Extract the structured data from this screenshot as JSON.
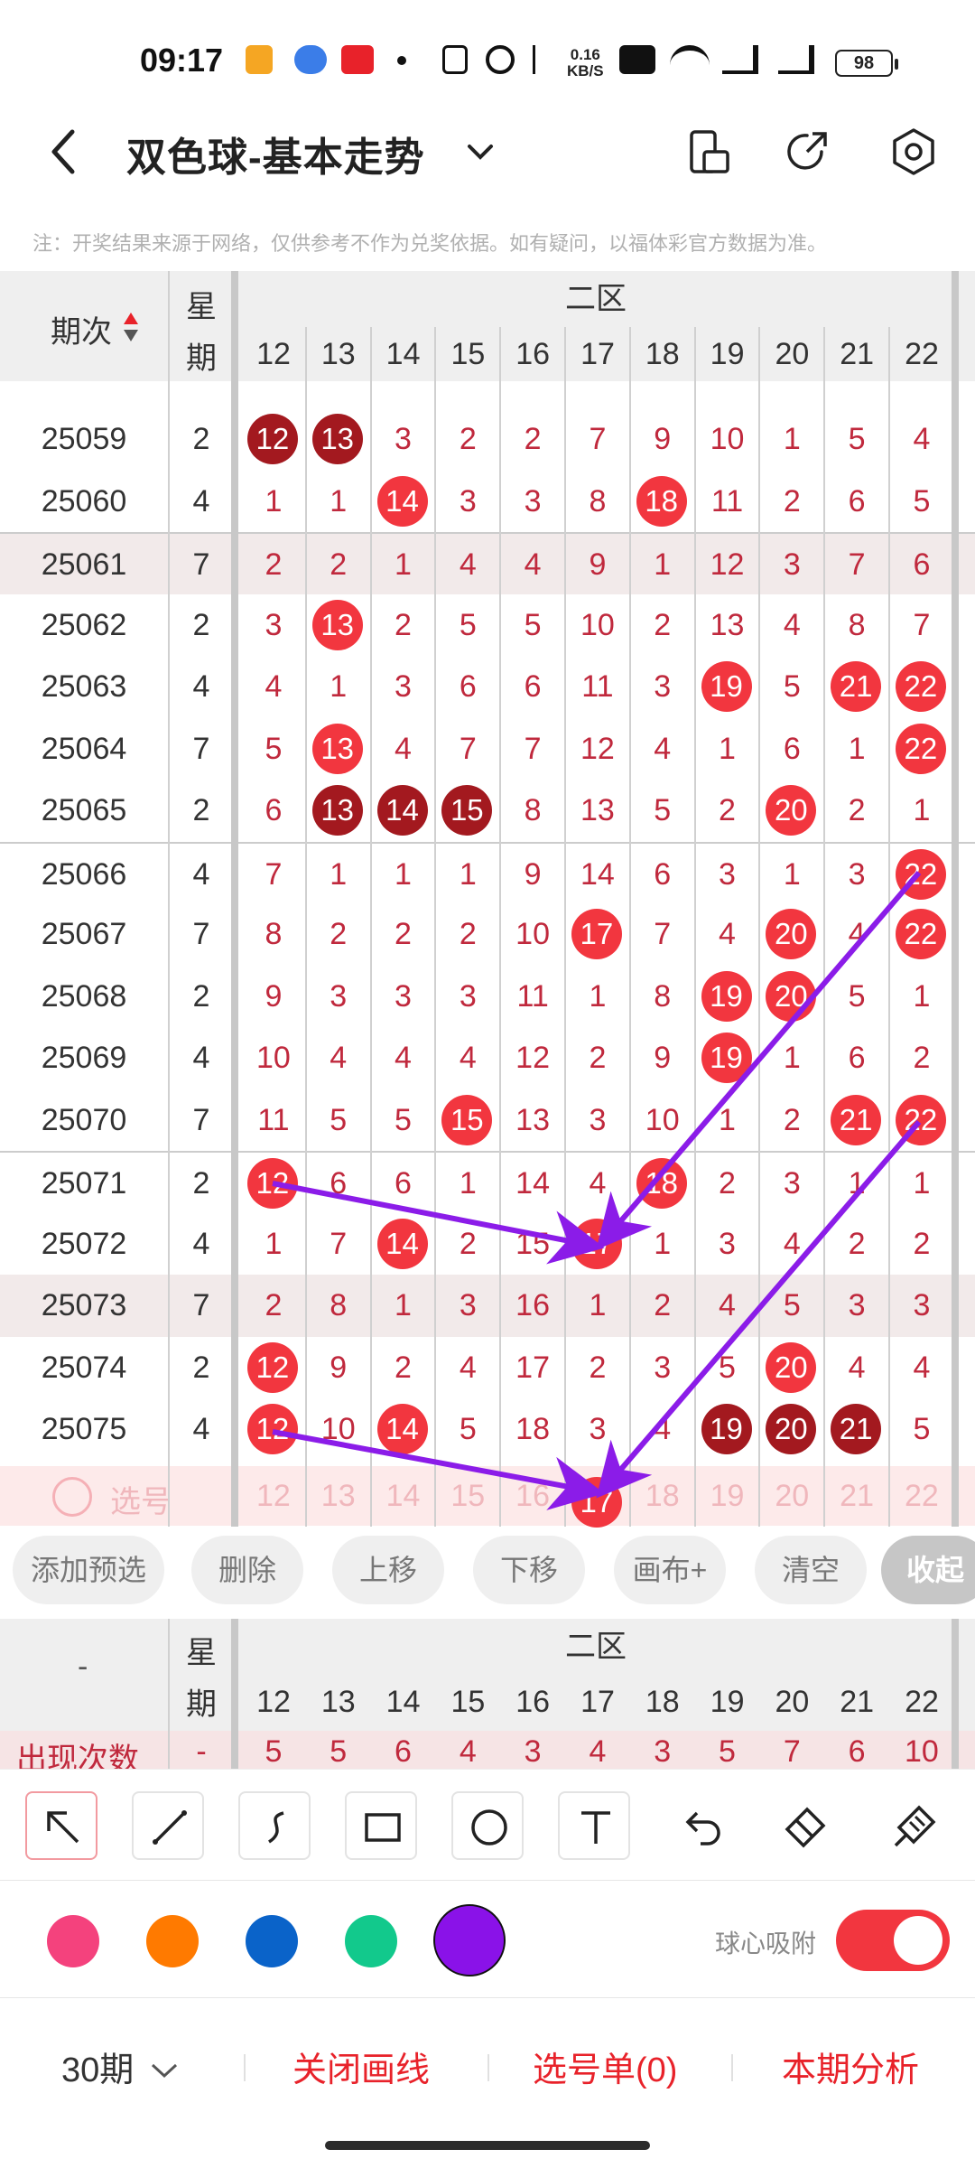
{
  "status_bar": {
    "time": "09:17",
    "net_speed_top": "0.16",
    "net_speed_bottom": "KB/S",
    "battery": "98"
  },
  "header": {
    "title": "双色球-基本走势"
  },
  "notice": "注：开奖结果来源于网络，仅供参考不作为兑奖依据。如有疑问，以福体彩官方数据为准。",
  "table": {
    "period_header": "期次",
    "week_header_top": "星",
    "week_header_bottom": "期",
    "zone_label": "二区",
    "columns": [
      "12",
      "13",
      "14",
      "15",
      "16",
      "17",
      "18",
      "19",
      "20",
      "21",
      "22"
    ],
    "rows": [
      {
        "period": "25059",
        "week": "2",
        "cells": [
          "12",
          "13",
          "3",
          "2",
          "2",
          "7",
          "9",
          "10",
          "1",
          "5",
          "4"
        ],
        "balls": {
          "0": "dark",
          "1": "dark"
        }
      },
      {
        "period": "25060",
        "week": "4",
        "cells": [
          "1",
          "1",
          "14",
          "3",
          "3",
          "8",
          "18",
          "11",
          "2",
          "6",
          "5"
        ],
        "balls": {
          "2": "red",
          "6": "red"
        }
      },
      {
        "period": "25061",
        "week": "7",
        "cells": [
          "2",
          "2",
          "1",
          "4",
          "4",
          "9",
          "1",
          "12",
          "3",
          "7",
          "6"
        ],
        "balls": {}
      },
      {
        "period": "25062",
        "week": "2",
        "cells": [
          "3",
          "13",
          "2",
          "5",
          "5",
          "10",
          "2",
          "13",
          "4",
          "8",
          "7"
        ],
        "balls": {
          "1": "red"
        }
      },
      {
        "period": "25063",
        "week": "4",
        "cells": [
          "4",
          "1",
          "3",
          "6",
          "6",
          "11",
          "3",
          "19",
          "5",
          "21",
          "22"
        ],
        "balls": {
          "7": "red",
          "9": "red",
          "10": "red"
        }
      },
      {
        "period": "25064",
        "week": "7",
        "cells": [
          "5",
          "13",
          "4",
          "7",
          "7",
          "12",
          "4",
          "1",
          "6",
          "1",
          "22"
        ],
        "balls": {
          "1": "red",
          "10": "red"
        }
      },
      {
        "period": "25065",
        "week": "2",
        "cells": [
          "6",
          "13",
          "14",
          "15",
          "8",
          "13",
          "5",
          "2",
          "20",
          "2",
          "1"
        ],
        "balls": {
          "1": "dark",
          "2": "dark",
          "3": "dark",
          "8": "red"
        }
      },
      {
        "period": "25066",
        "week": "4",
        "cells": [
          "7",
          "1",
          "1",
          "1",
          "9",
          "14",
          "6",
          "3",
          "1",
          "3",
          "22"
        ],
        "balls": {
          "10": "red"
        }
      },
      {
        "period": "25067",
        "week": "7",
        "cells": [
          "8",
          "2",
          "2",
          "2",
          "10",
          "17",
          "7",
          "4",
          "20",
          "4",
          "22"
        ],
        "balls": {
          "5": "red",
          "8": "red",
          "10": "red"
        }
      },
      {
        "period": "25068",
        "week": "2",
        "cells": [
          "9",
          "3",
          "3",
          "3",
          "11",
          "1",
          "8",
          "19",
          "20",
          "5",
          "1"
        ],
        "balls": {
          "7": "red",
          "8": "red"
        }
      },
      {
        "period": "25069",
        "week": "4",
        "cells": [
          "10",
          "4",
          "4",
          "4",
          "12",
          "2",
          "9",
          "19",
          "1",
          "6",
          "2"
        ],
        "balls": {
          "7": "red"
        }
      },
      {
        "period": "25070",
        "week": "7",
        "cells": [
          "11",
          "5",
          "5",
          "15",
          "13",
          "3",
          "10",
          "1",
          "2",
          "21",
          "22"
        ],
        "balls": {
          "3": "red",
          "9": "red",
          "10": "red"
        }
      },
      {
        "period": "25071",
        "week": "2",
        "cells": [
          "12",
          "6",
          "6",
          "1",
          "14",
          "4",
          "18",
          "2",
          "3",
          "1",
          "1"
        ],
        "balls": {
          "0": "red",
          "6": "red"
        }
      },
      {
        "period": "25072",
        "week": "4",
        "cells": [
          "1",
          "7",
          "14",
          "2",
          "15",
          "17",
          "1",
          "3",
          "4",
          "2",
          "2"
        ],
        "balls": {
          "2": "red",
          "5": "red"
        }
      },
      {
        "period": "25073",
        "week": "7",
        "cells": [
          "2",
          "8",
          "1",
          "3",
          "16",
          "1",
          "2",
          "4",
          "5",
          "3",
          "3"
        ],
        "balls": {}
      },
      {
        "period": "25074",
        "week": "2",
        "cells": [
          "12",
          "9",
          "2",
          "4",
          "17",
          "2",
          "3",
          "5",
          "20",
          "4",
          "4"
        ],
        "balls": {
          "0": "red",
          "8": "red"
        }
      },
      {
        "period": "25075",
        "week": "4",
        "cells": [
          "12",
          "10",
          "14",
          "5",
          "18",
          "3",
          "4",
          "19",
          "20",
          "21",
          "5"
        ],
        "balls": {
          "0": "red",
          "2": "red",
          "7": "dark",
          "8": "dark",
          "9": "dark"
        }
      }
    ],
    "select_row": {
      "label": "选号",
      "cells": [
        "12",
        "13",
        "14",
        "15",
        "16",
        "17",
        "18",
        "19",
        "20",
        "21",
        "22"
      ],
      "ball_index": 5
    }
  },
  "actions": {
    "add": "添加预选",
    "delete": "删除",
    "up": "上移",
    "down": "下移",
    "canvas": "画布+",
    "clear": "清空",
    "collapse": "收起"
  },
  "stats": {
    "left_label": "-",
    "week_top": "星",
    "week_bottom": "期",
    "zone_label": "二区",
    "row_label": "出现次数",
    "row_week": "-",
    "values": [
      "5",
      "5",
      "6",
      "4",
      "3",
      "4",
      "3",
      "5",
      "7",
      "6",
      "10"
    ]
  },
  "toolbar": {
    "icons": [
      "arrow-icon",
      "line-icon",
      "curve-icon",
      "rectangle-icon",
      "circle-icon",
      "text-icon",
      "undo-icon",
      "eraser-icon",
      "broom-icon"
    ]
  },
  "colors": {
    "palette": [
      "#f4427d",
      "#ff7a00",
      "#0a63c9",
      "#12c98c",
      "#8a12e8"
    ],
    "selected": "#8a12e8",
    "accent": "#f2363f",
    "arrow": "#8b1ce8"
  },
  "snap": {
    "label": "球心吸附",
    "on": true
  },
  "bottom": {
    "period_select": "30期",
    "close_lines": "关闭画线",
    "selection": "选号单(0)",
    "analysis": "本期分析"
  }
}
